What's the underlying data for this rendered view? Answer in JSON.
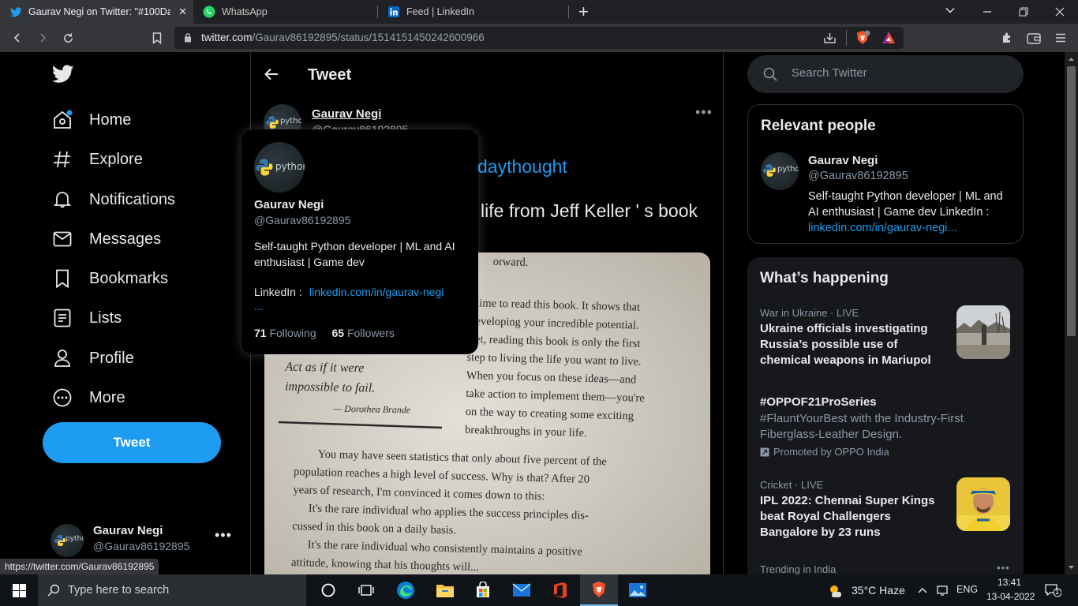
{
  "browser": {
    "tabs": [
      {
        "title": "Gaurav Negi on Twitter: \"#100Days",
        "icon": "twitter-icon",
        "active": true
      },
      {
        "title": "WhatsApp",
        "icon": "whatsapp-icon",
        "active": false
      },
      {
        "title": "Feed | LinkedIn",
        "icon": "linkedin-icon",
        "active": false
      }
    ],
    "url_host": "twitter.com",
    "url_path": "/Gaurav86192895/status/1514151450242600966",
    "status_url": "https://twitter.com/Gaurav86192895",
    "colors": {
      "tabbar": "#202124",
      "toolbar": "#35363a"
    }
  },
  "nav": {
    "items": [
      {
        "label": "Home",
        "icon": "home-icon"
      },
      {
        "label": "Explore",
        "icon": "hashtag-icon"
      },
      {
        "label": "Notifications",
        "icon": "bell-icon"
      },
      {
        "label": "Messages",
        "icon": "mail-icon"
      },
      {
        "label": "Bookmarks",
        "icon": "bookmark-icon"
      },
      {
        "label": "Lists",
        "icon": "list-icon"
      },
      {
        "label": "Profile",
        "icon": "person-icon"
      },
      {
        "label": "More",
        "icon": "more-circle-icon"
      }
    ],
    "tweet_button": "Tweet",
    "account": {
      "name": "Gaurav Negi",
      "handle": "@Gaurav86192895"
    }
  },
  "center": {
    "title": "Tweet",
    "author": {
      "name": "Gaurav Negi",
      "handle": "@Gaurav86192895",
      "avatar_text": "python"
    },
    "text_hashtag_visible": "daythought",
    "text_line2_visible": "r life from Jeff Keller ' s book",
    "image": {
      "lines_top": [
        "orward.",
        "time to read this book. It shows that",
        "eveloping your incredible potential.",
        "et, reading this book is only the first",
        "step to living the life you want to live.",
        "When you focus on these ideas—and",
        "take action to implement them—you're",
        "on the way to creating some exciting",
        "breakthroughs in your life."
      ],
      "quote": [
        "Act as if it were",
        "impossible to fail."
      ],
      "quote_author": "— Dorothea Brande",
      "paragraph": [
        "You may have seen statistics that only about five percent of the",
        "population reaches a high level of success. Why is that? After 20",
        "years of research, I'm convinced it comes down to this:",
        "It's the rare individual who applies the success principles dis-",
        "cussed in this book on a daily basis.",
        "It's the rare individual who consistently maintains a positive",
        "attitude, knowing that his thoughts will..."
      ]
    }
  },
  "hovercard": {
    "name": "Gaurav Negi",
    "handle": "@Gaurav86192895",
    "avatar_text": "python",
    "bio": "Self-taught Python developer | ML and AI enthusiast | Game dev",
    "linkedin_label": "LinkedIn :",
    "linkedin_link": "linkedin.com/in/gaurav-negi",
    "ellipsis": "...",
    "following_count": "71",
    "following_label": "Following",
    "followers_count": "65",
    "followers_label": "Followers"
  },
  "right": {
    "search_placeholder": "Search Twitter",
    "relevant": {
      "title": "Relevant people",
      "name": "Gaurav Negi",
      "handle": "@Gaurav86192895",
      "bio": "Self-taught Python developer | ML and AI enthusiast | Game dev LinkedIn :",
      "link": "linkedin.com/in/gaurav-negi..."
    },
    "happening": {
      "title": "What’s happening",
      "trends": [
        {
          "meta": "War in Ukraine · LIVE",
          "headline": "Ukraine officials investigating Russia’s possible use of chemical weapons in Mariupol"
        },
        {
          "meta": "",
          "headline": "#OPPOF21ProSeries",
          "desc": "#FlauntYourBest with the Industry-First Fiberglass-Leather Design.",
          "promo": "Promoted by OPPO India"
        },
        {
          "meta": "Cricket · LIVE",
          "headline": "IPL 2022: Chennai Super Kings beat Royal Challengers Bangalore by 23 runs"
        },
        {
          "meta": "Trending in India",
          "headline": ""
        }
      ]
    }
  },
  "taskbar": {
    "search_text": "Type here to search",
    "weather": "35°C  Haze",
    "lang": "ENG",
    "time": "13:41",
    "date": "13-04-2022",
    "notification_count": "1"
  }
}
